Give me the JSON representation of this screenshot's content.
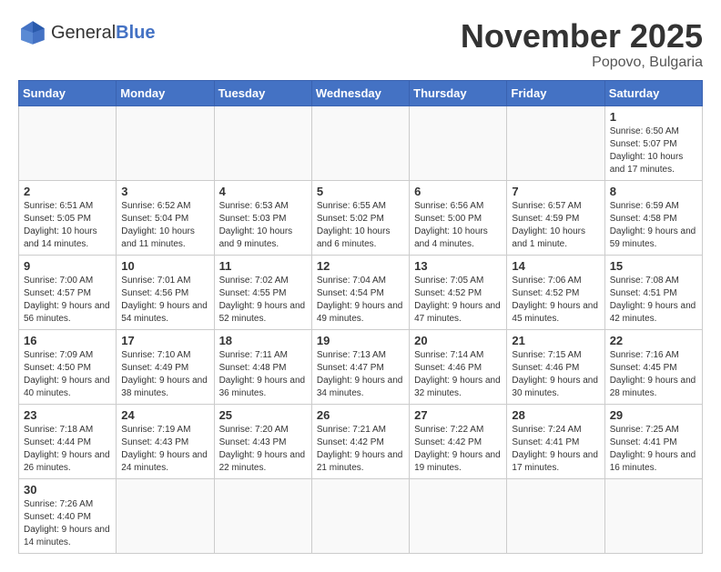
{
  "header": {
    "logo_general": "General",
    "logo_blue": "Blue",
    "month_title": "November 2025",
    "location": "Popovo, Bulgaria"
  },
  "weekdays": [
    "Sunday",
    "Monday",
    "Tuesday",
    "Wednesday",
    "Thursday",
    "Friday",
    "Saturday"
  ],
  "days": {
    "d1": {
      "num": "1",
      "info": "Sunrise: 6:50 AM\nSunset: 5:07 PM\nDaylight: 10 hours and 17 minutes."
    },
    "d2": {
      "num": "2",
      "info": "Sunrise: 6:51 AM\nSunset: 5:05 PM\nDaylight: 10 hours and 14 minutes."
    },
    "d3": {
      "num": "3",
      "info": "Sunrise: 6:52 AM\nSunset: 5:04 PM\nDaylight: 10 hours and 11 minutes."
    },
    "d4": {
      "num": "4",
      "info": "Sunrise: 6:53 AM\nSunset: 5:03 PM\nDaylight: 10 hours and 9 minutes."
    },
    "d5": {
      "num": "5",
      "info": "Sunrise: 6:55 AM\nSunset: 5:02 PM\nDaylight: 10 hours and 6 minutes."
    },
    "d6": {
      "num": "6",
      "info": "Sunrise: 6:56 AM\nSunset: 5:00 PM\nDaylight: 10 hours and 4 minutes."
    },
    "d7": {
      "num": "7",
      "info": "Sunrise: 6:57 AM\nSunset: 4:59 PM\nDaylight: 10 hours and 1 minute."
    },
    "d8": {
      "num": "8",
      "info": "Sunrise: 6:59 AM\nSunset: 4:58 PM\nDaylight: 9 hours and 59 minutes."
    },
    "d9": {
      "num": "9",
      "info": "Sunrise: 7:00 AM\nSunset: 4:57 PM\nDaylight: 9 hours and 56 minutes."
    },
    "d10": {
      "num": "10",
      "info": "Sunrise: 7:01 AM\nSunset: 4:56 PM\nDaylight: 9 hours and 54 minutes."
    },
    "d11": {
      "num": "11",
      "info": "Sunrise: 7:02 AM\nSunset: 4:55 PM\nDaylight: 9 hours and 52 minutes."
    },
    "d12": {
      "num": "12",
      "info": "Sunrise: 7:04 AM\nSunset: 4:54 PM\nDaylight: 9 hours and 49 minutes."
    },
    "d13": {
      "num": "13",
      "info": "Sunrise: 7:05 AM\nSunset: 4:52 PM\nDaylight: 9 hours and 47 minutes."
    },
    "d14": {
      "num": "14",
      "info": "Sunrise: 7:06 AM\nSunset: 4:52 PM\nDaylight: 9 hours and 45 minutes."
    },
    "d15": {
      "num": "15",
      "info": "Sunrise: 7:08 AM\nSunset: 4:51 PM\nDaylight: 9 hours and 42 minutes."
    },
    "d16": {
      "num": "16",
      "info": "Sunrise: 7:09 AM\nSunset: 4:50 PM\nDaylight: 9 hours and 40 minutes."
    },
    "d17": {
      "num": "17",
      "info": "Sunrise: 7:10 AM\nSunset: 4:49 PM\nDaylight: 9 hours and 38 minutes."
    },
    "d18": {
      "num": "18",
      "info": "Sunrise: 7:11 AM\nSunset: 4:48 PM\nDaylight: 9 hours and 36 minutes."
    },
    "d19": {
      "num": "19",
      "info": "Sunrise: 7:13 AM\nSunset: 4:47 PM\nDaylight: 9 hours and 34 minutes."
    },
    "d20": {
      "num": "20",
      "info": "Sunrise: 7:14 AM\nSunset: 4:46 PM\nDaylight: 9 hours and 32 minutes."
    },
    "d21": {
      "num": "21",
      "info": "Sunrise: 7:15 AM\nSunset: 4:46 PM\nDaylight: 9 hours and 30 minutes."
    },
    "d22": {
      "num": "22",
      "info": "Sunrise: 7:16 AM\nSunset: 4:45 PM\nDaylight: 9 hours and 28 minutes."
    },
    "d23": {
      "num": "23",
      "info": "Sunrise: 7:18 AM\nSunset: 4:44 PM\nDaylight: 9 hours and 26 minutes."
    },
    "d24": {
      "num": "24",
      "info": "Sunrise: 7:19 AM\nSunset: 4:43 PM\nDaylight: 9 hours and 24 minutes."
    },
    "d25": {
      "num": "25",
      "info": "Sunrise: 7:20 AM\nSunset: 4:43 PM\nDaylight: 9 hours and 22 minutes."
    },
    "d26": {
      "num": "26",
      "info": "Sunrise: 7:21 AM\nSunset: 4:42 PM\nDaylight: 9 hours and 21 minutes."
    },
    "d27": {
      "num": "27",
      "info": "Sunrise: 7:22 AM\nSunset: 4:42 PM\nDaylight: 9 hours and 19 minutes."
    },
    "d28": {
      "num": "28",
      "info": "Sunrise: 7:24 AM\nSunset: 4:41 PM\nDaylight: 9 hours and 17 minutes."
    },
    "d29": {
      "num": "29",
      "info": "Sunrise: 7:25 AM\nSunset: 4:41 PM\nDaylight: 9 hours and 16 minutes."
    },
    "d30": {
      "num": "30",
      "info": "Sunrise: 7:26 AM\nSunset: 4:40 PM\nDaylight: 9 hours and 14 minutes."
    }
  }
}
